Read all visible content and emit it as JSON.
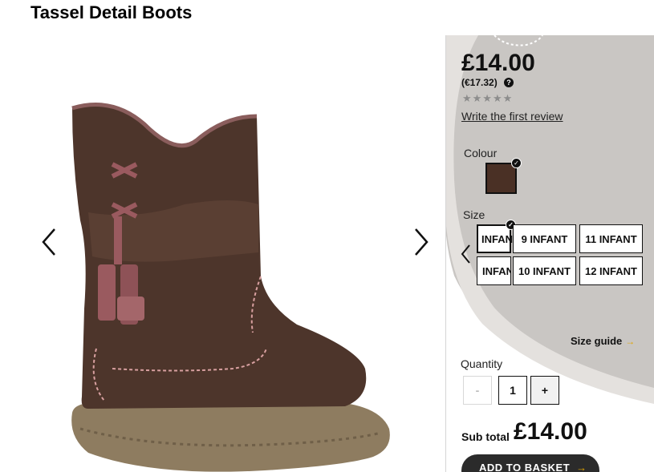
{
  "product": {
    "title": "Tassel Detail Boots",
    "price": "£14.00",
    "price_eur": "(€17.32)",
    "rating_stars": "★★★★★",
    "rating": 0,
    "review_link": "Write the first review"
  },
  "gallery": {
    "prev_icon": "chevron-left-icon",
    "next_icon": "chevron-right-icon"
  },
  "colour": {
    "label": "Colour",
    "selected_hex": "#4a3025"
  },
  "size": {
    "label": "Size",
    "options": [
      {
        "label": "INFANT",
        "selected": true
      },
      {
        "label": "9 INFANT",
        "selected": false
      },
      {
        "label": "11 INFANT",
        "selected": false
      },
      {
        "label": "INFANT",
        "selected": false
      },
      {
        "label": "10 INFANT",
        "selected": false
      },
      {
        "label": "12 INFANT",
        "selected": false
      }
    ],
    "guide": "Size guide",
    "guide_arrow": "→"
  },
  "quantity": {
    "label": "Quantity",
    "minus": "-",
    "value": "1",
    "plus": "+"
  },
  "subtotal": {
    "label": "Sub total",
    "value": "£14.00"
  },
  "basket": {
    "label": "ADD TO BASKET",
    "arrow": "→"
  },
  "colors": {
    "accent_arrow": "#e0a400",
    "button_dark": "#2b2b2b",
    "boot_brown": "#4a3025"
  }
}
